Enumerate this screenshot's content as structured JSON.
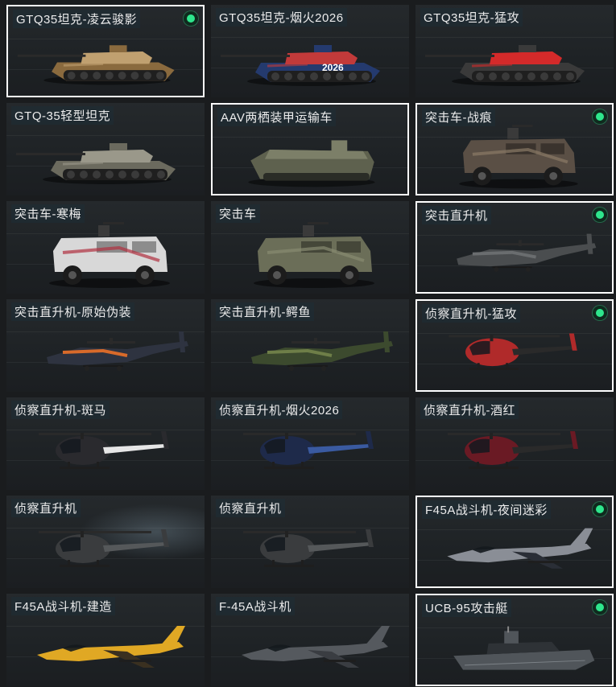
{
  "accent": "#2ee68c",
  "cards": [
    {
      "label": "GTQ35坦克-凌云骏影",
      "kind": "tank",
      "camo": "#8a6a3e",
      "camo2": "#c0a070",
      "selected": true,
      "owned": true
    },
    {
      "label": "GTQ35坦克-烟火2026",
      "kind": "tank",
      "camo": "#243a6e",
      "camo2": "#c23a3a",
      "selected": false,
      "owned": false,
      "decal": "2026"
    },
    {
      "label": "GTQ35坦克-猛攻",
      "kind": "tank",
      "camo": "#3a3a3a",
      "camo2": "#d42a2a",
      "selected": false,
      "owned": false
    },
    {
      "label": "GTQ-35轻型坦克",
      "kind": "tank",
      "camo": "#6b6a5e",
      "camo2": "#9a988a",
      "selected": false,
      "owned": false
    },
    {
      "label": "AAV两栖装甲运输车",
      "kind": "aav",
      "camo": "#5e614e",
      "camo2": "#7c7f68",
      "selected": true,
      "owned": false
    },
    {
      "label": "突击车-战痕",
      "kind": "truck",
      "camo": "#5a4f45",
      "camo2": "#8a7a66",
      "selected": true,
      "owned": true
    },
    {
      "label": "突击车-寒梅",
      "kind": "truck",
      "camo": "#d8d8d8",
      "camo2": "#b03040",
      "selected": false,
      "owned": false
    },
    {
      "label": "突击车",
      "kind": "truck",
      "camo": "#6b6e58",
      "camo2": "#878a70",
      "selected": false,
      "owned": false
    },
    {
      "label": "突击直升机",
      "kind": "apache",
      "camo": "#4a4d4f",
      "camo2": "#6a6d6f",
      "selected": true,
      "owned": true
    },
    {
      "label": "突击直升机-原始伪装",
      "kind": "apache",
      "camo": "#2e3340",
      "camo2": "#d86a2a",
      "selected": false,
      "owned": false
    },
    {
      "label": "突击直升机-鳄鱼",
      "kind": "apache",
      "camo": "#3c4a2e",
      "camo2": "#6e7e48",
      "selected": false,
      "owned": false
    },
    {
      "label": "侦察直升机-猛攻",
      "kind": "scout",
      "camo": "#b02a2a",
      "camo2": "#2a2a2a",
      "selected": true,
      "owned": true
    },
    {
      "label": "侦察直升机-斑马",
      "kind": "scout",
      "camo": "#2a2a2e",
      "camo2": "#e6e6e6",
      "selected": false,
      "owned": false
    },
    {
      "label": "侦察直升机-烟火2026",
      "kind": "scout",
      "camo": "#1e2a4a",
      "camo2": "#3a5aa0",
      "selected": false,
      "owned": false
    },
    {
      "label": "侦察直升机-酒红",
      "kind": "scout",
      "camo": "#6a1a24",
      "camo2": "#2a2a2a",
      "selected": false,
      "owned": false
    },
    {
      "label": "侦察直升机",
      "kind": "scout",
      "camo": "#3a3c3e",
      "camo2": "#55585a",
      "selected": false,
      "owned": false,
      "spot": true
    },
    {
      "label": "侦察直升机",
      "kind": "scout",
      "camo": "#3a3c3e",
      "camo2": "#55585a",
      "selected": false,
      "owned": false
    },
    {
      "label": "F45A战斗机-夜间迷彩",
      "kind": "jet",
      "camo": "#8a8e96",
      "camo2": "#2a2e36",
      "selected": true,
      "owned": true
    },
    {
      "label": "F45A战斗机-建造",
      "kind": "jet",
      "camo": "#e0a824",
      "camo2": "#3a3020",
      "selected": false,
      "owned": false
    },
    {
      "label": "F-45A战斗机",
      "kind": "jet",
      "camo": "#55595e",
      "camo2": "#3a3d42",
      "selected": false,
      "owned": false
    },
    {
      "label": "UCB-95攻击艇",
      "kind": "boat",
      "camo": "#50555a",
      "camo2": "#2e3236",
      "selected": true,
      "owned": true
    }
  ]
}
